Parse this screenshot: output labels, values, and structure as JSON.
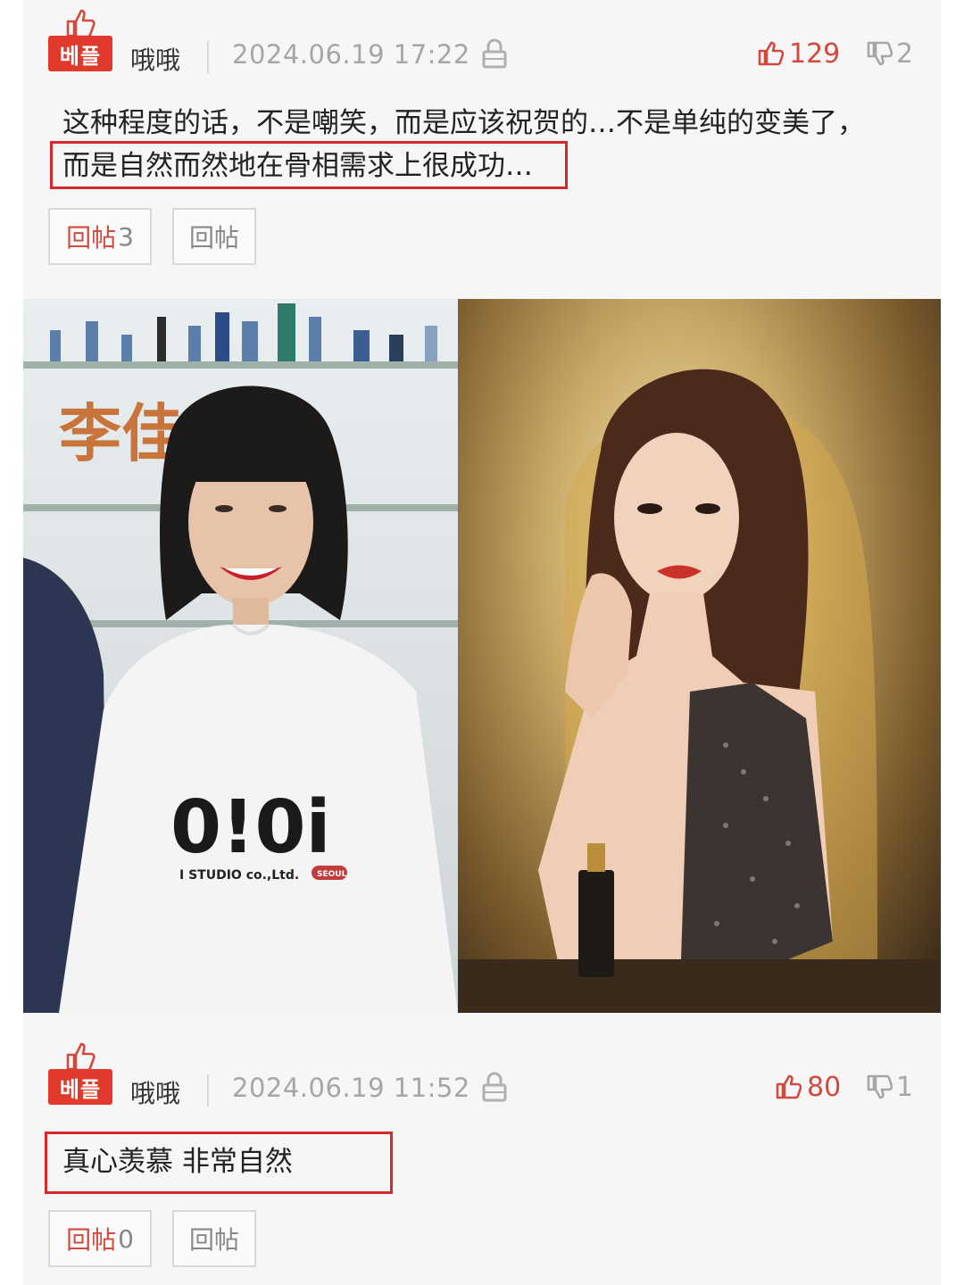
{
  "comments": [
    {
      "badge": "베플",
      "username": "哦哦",
      "date": "2024.06.19 17:22",
      "likes": "129",
      "dislikes": "2",
      "text_line1": "这种程度的话，不是嘲笑，而是应该祝贺的…不是单纯的变美了，",
      "text_line2": "而是自然而然地在骨相需求上很成功…",
      "reply_label": "回帖",
      "reply_count": "3",
      "reply_button": "回帖"
    },
    {
      "badge": "베플",
      "username": "哦哦",
      "date": "2024.06.19 11:52",
      "likes": "80",
      "dislikes": "1",
      "text": "真心羡慕 非常自然",
      "reply_label": "回帖",
      "reply_count": "0",
      "reply_button": "回帖"
    }
  ],
  "photos": {
    "left_sign_text": "李佳",
    "left_shirt_logo": "0!0i",
    "left_shirt_sub": "I STUDIO co.,Ltd.",
    "left_shirt_tag": "SEOUL"
  },
  "colors": {
    "badge": "#e03a2d",
    "highlight_box": "#d6272d",
    "like": "#d04a3f",
    "muted": "#a6a6a6"
  },
  "icons": {
    "thumb_badge": "thumbs-up-icon",
    "lock": "lock-icon",
    "like": "thumbs-up-icon",
    "dislike": "thumbs-down-icon"
  }
}
